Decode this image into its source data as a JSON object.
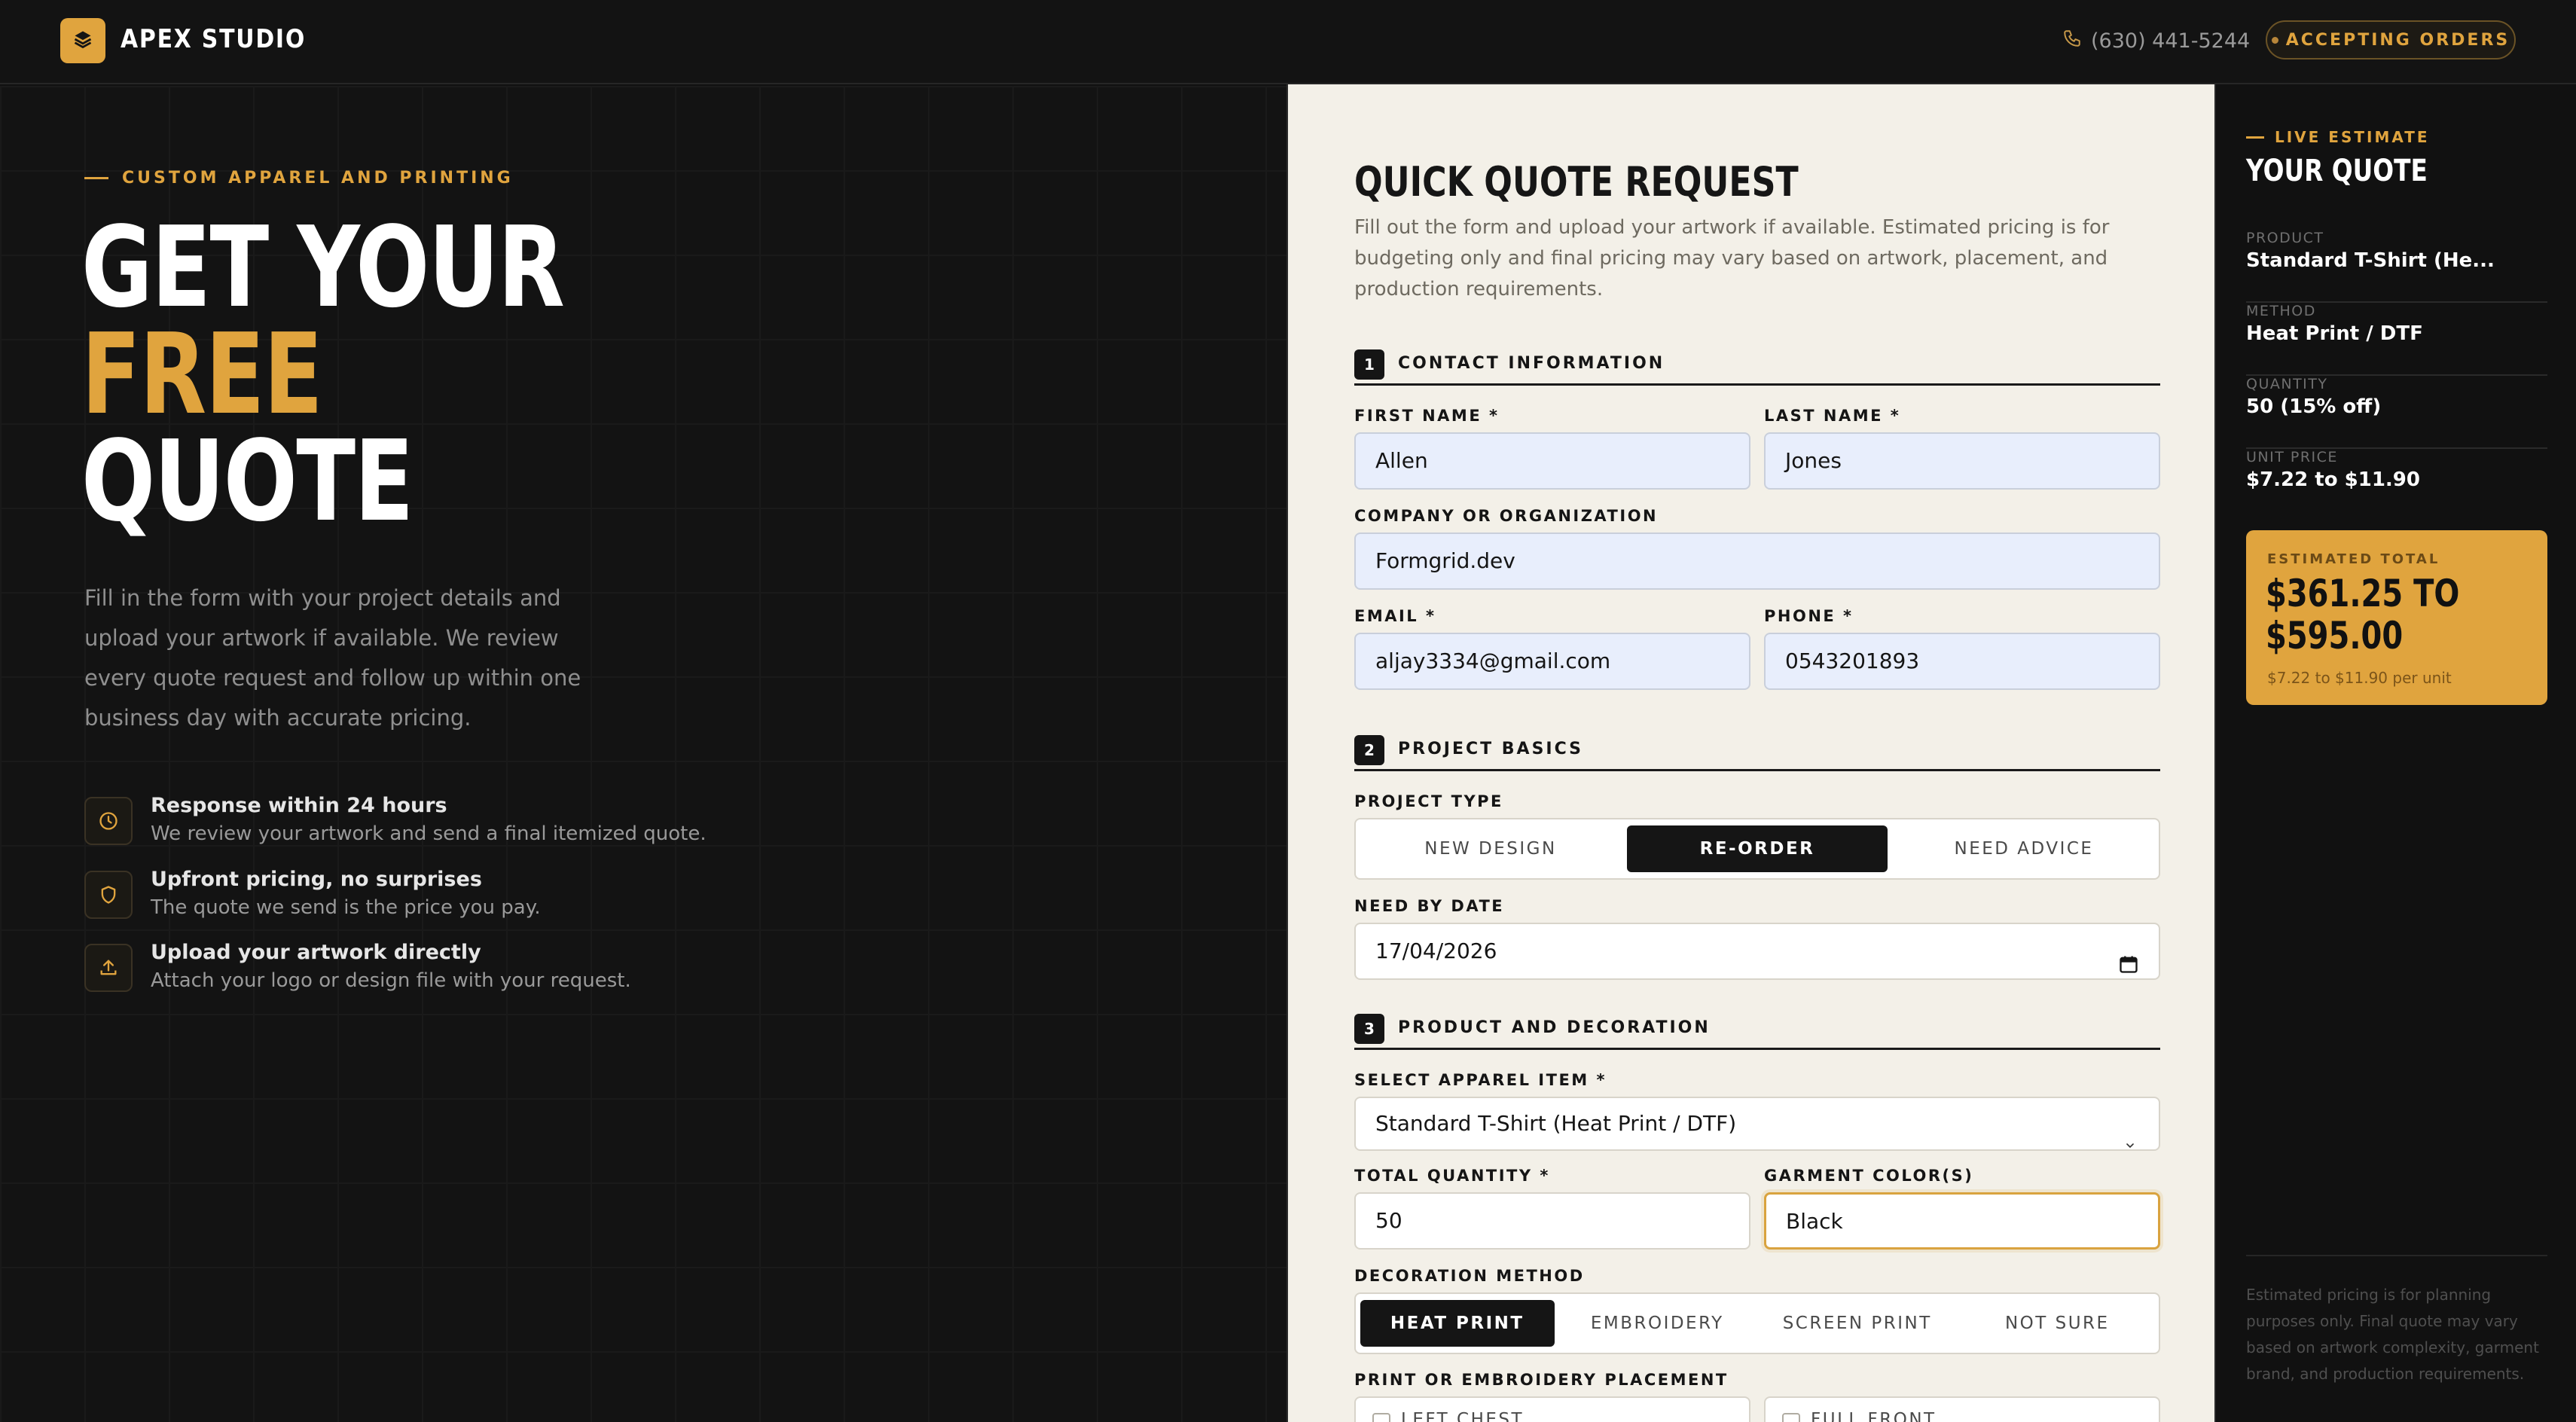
{
  "header": {
    "brand": "APEX STUDIO",
    "phone": "(630) 441-5244",
    "status_badge": "ACCEPTING ORDERS",
    "accent_color": "#e0a43e"
  },
  "hero": {
    "eyebrow": "CUSTOM APPAREL AND PRINTING",
    "title_line1": "GET YOUR",
    "title_line2": "FREE",
    "title_line3": "QUOTE",
    "description": "Fill in the form with your project details and upload your artwork if available. We review every quote request and follow up within one business day with accurate pricing.",
    "features": [
      {
        "icon": "clock-icon",
        "title": "Response within 24 hours",
        "subtitle": "We review your artwork and send a final itemized quote."
      },
      {
        "icon": "shield-icon",
        "title": "Upfront pricing, no surprises",
        "subtitle": "The quote we send is the price you pay."
      },
      {
        "icon": "upload-icon",
        "title": "Upload your artwork directly",
        "subtitle": "Attach your logo or design file with your request."
      }
    ]
  },
  "form": {
    "title": "QUICK QUOTE REQUEST",
    "description": "Fill out the form and upload your artwork if available. Estimated pricing is for budgeting only and final pricing may vary based on artwork, placement, and production requirements.",
    "sections": [
      {
        "num": "1",
        "title": "CONTACT INFORMATION"
      },
      {
        "num": "2",
        "title": "PROJECT BASICS"
      },
      {
        "num": "3",
        "title": "PRODUCT AND DECORATION"
      }
    ],
    "first_name": {
      "label": "FIRST NAME *",
      "value": "Allen"
    },
    "last_name": {
      "label": "LAST NAME *",
      "value": "Jones"
    },
    "company": {
      "label": "COMPANY OR ORGANIZATION",
      "value": "Formgrid.dev"
    },
    "email": {
      "label": "EMAIL *",
      "value": "aljay3334@gmail.com"
    },
    "phone": {
      "label": "PHONE *",
      "value": "0543201893"
    },
    "project_type": {
      "label": "PROJECT TYPE",
      "options": [
        "NEW DESIGN",
        "RE-ORDER",
        "NEED ADVICE"
      ],
      "selected": "RE-ORDER"
    },
    "need_by": {
      "label": "NEED BY DATE",
      "value": "17/04/2026"
    },
    "apparel": {
      "label": "SELECT APPAREL ITEM *",
      "value": "Standard T-Shirt (Heat Print / DTF)"
    },
    "quantity": {
      "label": "TOTAL QUANTITY *",
      "value": "50"
    },
    "colors": {
      "label": "GARMENT COLOR(S)",
      "value": "Black"
    },
    "decoration": {
      "label": "DECORATION METHOD",
      "options": [
        "HEAT PRINT",
        "EMBROIDERY",
        "SCREEN PRINT",
        "NOT SURE"
      ],
      "selected": "HEAT PRINT"
    },
    "placement": {
      "label": "PRINT OR EMBROIDERY PLACEMENT",
      "options": [
        "LEFT CHEST",
        "FULL FRONT"
      ]
    }
  },
  "estimate": {
    "eyebrow": "LIVE ESTIMATE",
    "title": "YOUR QUOTE",
    "rows": [
      {
        "key": "PRODUCT",
        "value": "Standard T-Shirt (He..."
      },
      {
        "key": "METHOD",
        "value": "Heat Print / DTF"
      },
      {
        "key": "QUANTITY",
        "value": "50 (15% off)"
      },
      {
        "key": "UNIT PRICE",
        "value": "$7.22 to $11.90"
      }
    ],
    "total_label": "ESTIMATED TOTAL",
    "total_line1": "$361.25 TO",
    "total_line2": "$595.00",
    "total_sub": "$7.22 to $11.90 per unit",
    "footnote": "Estimated pricing is for planning purposes only. Final quote may vary based on artwork complexity, garment brand, and production requirements."
  }
}
